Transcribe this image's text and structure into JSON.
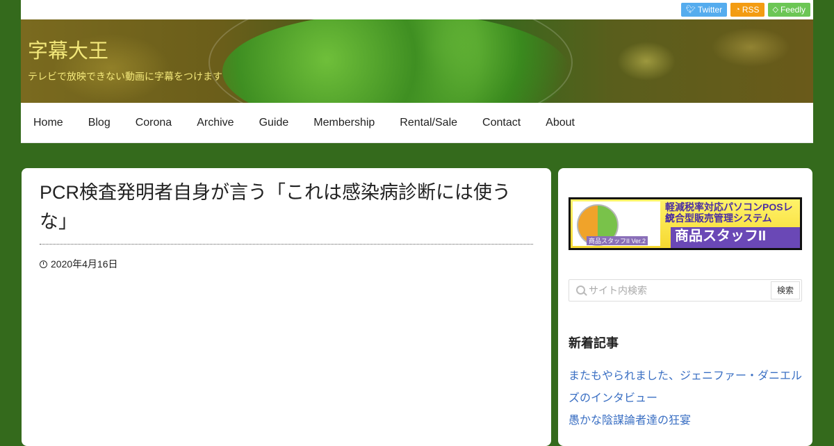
{
  "social": [
    {
      "label": "Twitter",
      "icon": "twitter-icon"
    },
    {
      "label": "RSS",
      "icon": "rss-icon"
    },
    {
      "label": "Feedly",
      "icon": "feedly-icon"
    }
  ],
  "header": {
    "title": "字幕大王",
    "description": "テレビで放映できない動画に字幕をつけます"
  },
  "nav": [
    "Home",
    "Blog",
    "Corona",
    "Archive",
    "Guide",
    "Membership",
    "Rental/Sale",
    "Contact",
    "About"
  ],
  "post": {
    "title": "PCR検査発明者自身が言う「これは感染病診断には使うな」",
    "date": "2020年4月16日"
  },
  "sidebar": {
    "banner": {
      "line1": "軽減税率対応パソコンPOSレジ",
      "line2": "統合型販売管理システム",
      "line3": "商品スタッフII Ver.2",
      "small_label": "商品スタッフII Ver.2"
    },
    "search": {
      "placeholder": "サイト内検索",
      "button": "検索"
    },
    "recent_title": "新着記事",
    "recent_posts": [
      "またもやられました、ジェニファー・ダニエルズのインタビュー",
      "愚かな陰謀論者達の狂宴"
    ]
  },
  "colors": {
    "background": "#346a1c",
    "site_title": "#f3e87a",
    "link": "#3a6fc3",
    "twitter": "#55acee",
    "rss": "#f39c12",
    "feedly": "#6cc655"
  }
}
